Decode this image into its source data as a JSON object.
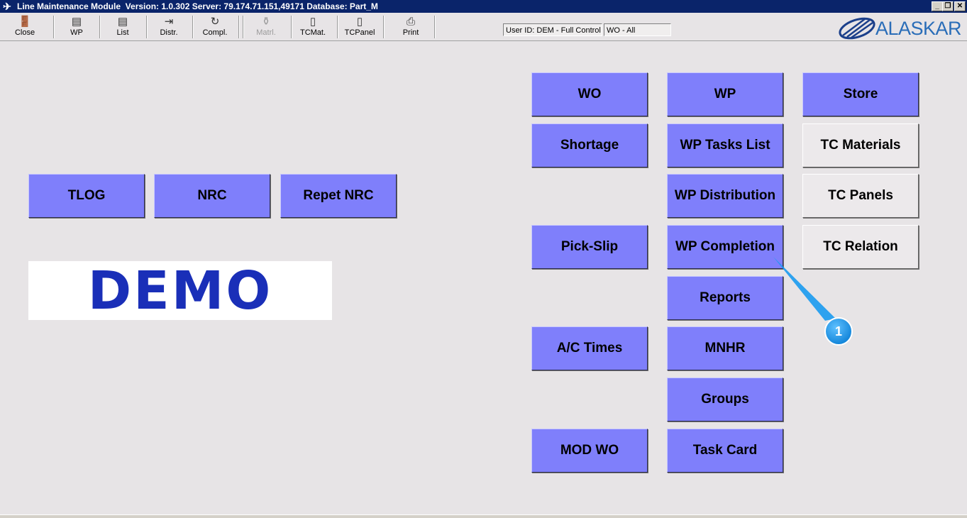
{
  "window": {
    "title": "Line Maintenance Module  Version: 1.0.302 Server: 79.174.71.151,49171 Database: Part_M",
    "app_icon": "✈",
    "controls": [
      "_",
      "❐",
      "✕"
    ]
  },
  "toolbar": {
    "buttons": [
      {
        "label": "Close",
        "icon": "door-icon",
        "glyph": "🚪"
      },
      {
        "label": "WP",
        "icon": "wp-icon",
        "glyph": "▤"
      },
      {
        "label": "List",
        "icon": "list-icon",
        "glyph": "▤"
      },
      {
        "label": "Distr.",
        "icon": "distr-icon",
        "glyph": "⇥"
      },
      {
        "label": "Compl.",
        "icon": "compl-icon",
        "glyph": "↻"
      },
      {
        "label": "Matrl.",
        "icon": "matrl-icon",
        "glyph": "⚱",
        "disabled": true
      },
      {
        "label": "TCMat.",
        "icon": "tcmat-icon",
        "glyph": "▯"
      },
      {
        "label": "TCPanel",
        "icon": "tcpanel-icon",
        "glyph": "▯"
      },
      {
        "label": "Print",
        "icon": "print-icon",
        "glyph": "⎙"
      }
    ],
    "user_field": "User ID: DEM - Full Control",
    "wo_field": "WO - All",
    "logo_text": "ALASKAR"
  },
  "main": {
    "left_buttons": [
      "TLOG",
      "NRC",
      "Repet NRC"
    ],
    "demo_text": "DEMO",
    "col1": [
      "WO",
      "Shortage",
      "Pick-Slip",
      "A/C Times",
      "MOD WO"
    ],
    "col2": [
      "WP",
      "WP Tasks List",
      "WP Distribution",
      "WP Completion",
      "Reports",
      "MNHR",
      "Groups",
      "Task Card"
    ],
    "col3": [
      "Store",
      "TC Materials",
      "TC Panels",
      "TC Relation"
    ]
  },
  "callout": {
    "number": "1",
    "color": "#1a9af0"
  }
}
